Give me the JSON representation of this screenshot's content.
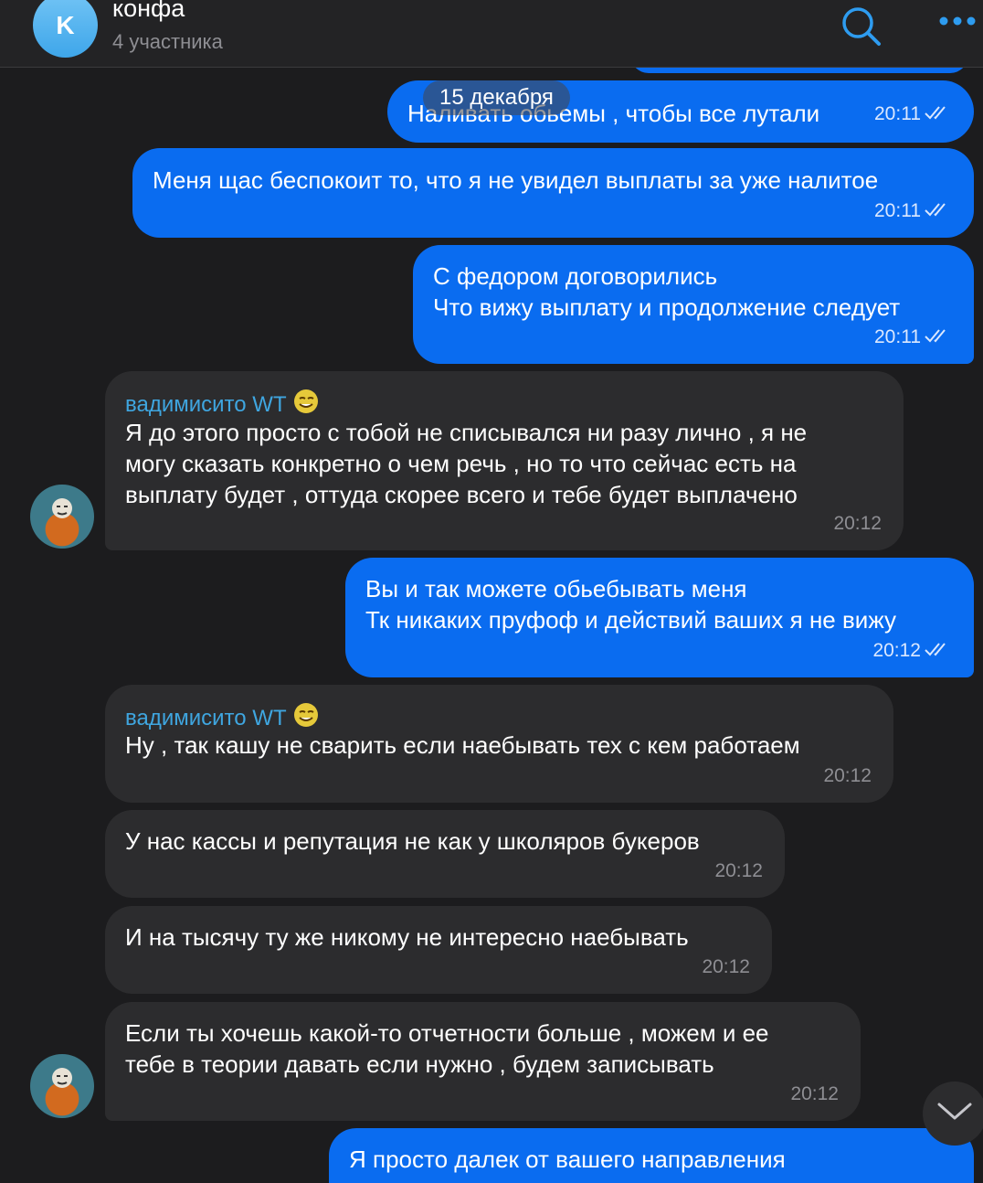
{
  "header": {
    "avatar_letter": "K",
    "title": "конфа",
    "subtitle": "4 участника",
    "search_icon": "search-icon",
    "more_icon": "more-icon"
  },
  "date_separator": "15 декабря",
  "messages": [
    {
      "text": "Наливать обьемы , чтобы все лутали",
      "time": "20:11",
      "dir": "out",
      "status": "read"
    },
    {
      "text": "Меня щас беспокоит то, что я не увидел выплаты за уже налитое",
      "time": "20:11",
      "dir": "out",
      "status": "read"
    },
    {
      "text": "С федором договорились\nЧто вижу выплату и продолжение следует",
      "time": "20:11",
      "dir": "out",
      "status": "read"
    },
    {
      "sender": "вадимисито WT",
      "text": "Я до этого просто с тобой не списывался ни разу лично , я не\nмогу сказать конкретно о чем речь , но то что сейчас есть на\nвыплату будет , оттуда скорее всего и тебе будет выплачено",
      "time": "20:12",
      "dir": "in"
    },
    {
      "text": "Вы и так можете обьебывать меня\nТк никаких пруфоф и действий ваших я не вижу",
      "time": "20:12",
      "dir": "out",
      "status": "read"
    },
    {
      "sender": "вадимисито WT",
      "text": "Ну , так кашу не сварить если наебывать тех с кем работаем",
      "time": "20:12",
      "dir": "in"
    },
    {
      "text": "У нас кассы и репутация не как у школяров букеров",
      "time": "20:12",
      "dir": "in"
    },
    {
      "text": "И на тысячу ту же никому не интересно наебывать",
      "time": "20:12",
      "dir": "in"
    },
    {
      "text": "Если ты хочешь какой-то отчетности больше , можем и ее\nтебе в теории давать если нужно , будем записывать",
      "time": "20:12",
      "dir": "in"
    },
    {
      "text": "Я просто далек от вашего направления",
      "dir": "out"
    }
  ],
  "colors": {
    "outgoing_bubble": "#0a6cf0",
    "incoming_bubble": "#2c2c2e",
    "sender_name": "#3fa6e0",
    "background": "#1c1c1e"
  }
}
